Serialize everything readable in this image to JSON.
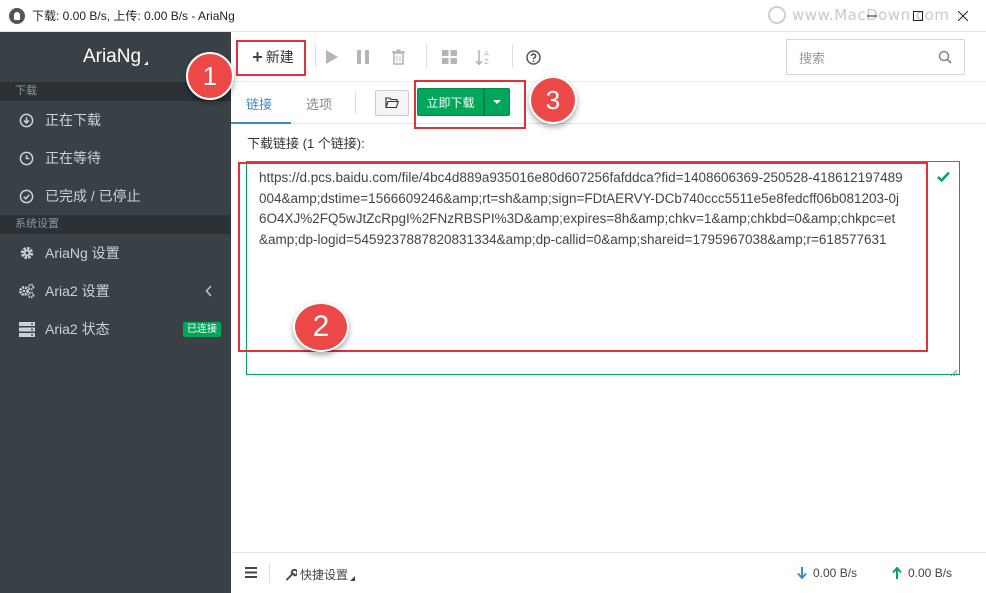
{
  "window": {
    "title": "下载: 0.00 B/s, 上传: 0.00 B/s - AriaNg",
    "watermark": "www.MacDown.com"
  },
  "sidebar": {
    "brand": "AriaNg",
    "section_download": "下载",
    "items_download": [
      {
        "label": "正在下载",
        "icon": "download-circle-icon"
      },
      {
        "label": "正在等待",
        "icon": "clock-icon"
      },
      {
        "label": "已完成 / 已停止",
        "icon": "check-circle-icon"
      }
    ],
    "section_settings": "系统设置",
    "items_settings": [
      {
        "label": "AriaNg 设置",
        "icon": "gear-icon"
      },
      {
        "label": "Aria2 设置",
        "icon": "gears-icon"
      },
      {
        "label": "Aria2 状态",
        "icon": "server-icon",
        "badge": "已连接"
      }
    ]
  },
  "toolbar": {
    "new_label": "新建",
    "search_placeholder": "搜索"
  },
  "tabs": {
    "link": "链接",
    "options": "选项"
  },
  "download_button": "立即下载",
  "form": {
    "label": "下载链接 (1 个链接):",
    "url_value": "https://d.pcs.baidu.com/file/4bc4d889a935016e80d607256fafddca?fid=1408606369-250528-418612197489004&amp;dstime=1566609246&amp;rt=sh&amp;sign=FDtAERVY-DCb740ccc5511e5e8fedcff06b081203-0j6O4XJ%2FQ5wJtZcRpgI%2FNzRBSPI%3D&amp;expires=8h&amp;chkv=1&amp;chkbd=0&amp;chkpc=et&amp;dp-logid=5459237887820831334&amp;dp-callid=0&amp;shareid=1795967038&amp;r=618577631"
  },
  "footer": {
    "quick_settings": "快捷设置",
    "download_speed": "0.00 B/s",
    "upload_speed": "0.00 B/s"
  },
  "annotations": [
    "1",
    "2",
    "3"
  ],
  "colors": {
    "sidebar_bg": "#3a4146",
    "accent_blue": "#3c8dbc",
    "success_green": "#00a65a",
    "annotation_red": "#ec4848"
  }
}
